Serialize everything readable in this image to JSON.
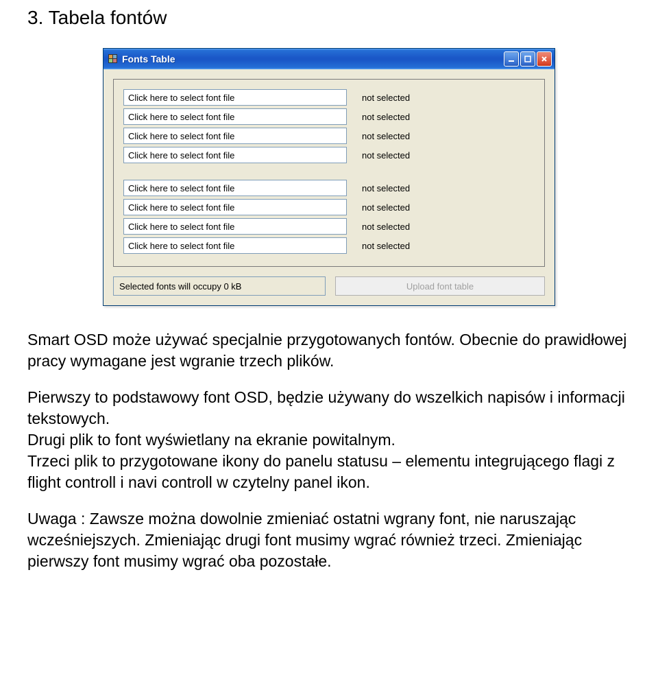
{
  "heading": "3.  Tabela fontów",
  "window": {
    "title": "Fonts Table",
    "groups": [
      [
        {
          "placeholder": "Click here to select font file",
          "status": "not selected"
        },
        {
          "placeholder": "Click here to select font file",
          "status": "not selected"
        },
        {
          "placeholder": "Click here to select font file",
          "status": "not selected"
        },
        {
          "placeholder": "Click here to select font file",
          "status": "not selected"
        }
      ],
      [
        {
          "placeholder": "Click here to select font file",
          "status": "not selected"
        },
        {
          "placeholder": "Click here to select font file",
          "status": "not selected"
        },
        {
          "placeholder": "Click here to select font file",
          "status": "not selected"
        },
        {
          "placeholder": "Click here to select font file",
          "status": "not selected"
        }
      ]
    ],
    "status_text": "Selected fonts will occupy 0 kB",
    "upload_label": "Upload font table"
  },
  "paragraphs": {
    "p1": "Smart OSD może używać specjalnie przygotowanych fontów. Obecnie do prawidłowej pracy wymagane jest wgranie trzech plików.",
    "p2a": "Pierwszy to podstawowy font OSD, będzie używany do wszelkich napisów i informacji tekstowych.",
    "p2b": "Drugi plik to font wyświetlany na ekranie powitalnym.",
    "p2c": "Trzeci plik to przygotowane ikony do panelu statusu – elementu integrującego flagi z flight controll i navi controll w czytelny panel ikon.",
    "p3": "Uwaga : Zawsze można dowolnie zmieniać ostatni wgrany font, nie naruszając wcześniejszych. Zmieniając drugi font musimy wgrać również trzeci. Zmieniając pierwszy font musimy wgrać oba pozostałe."
  }
}
